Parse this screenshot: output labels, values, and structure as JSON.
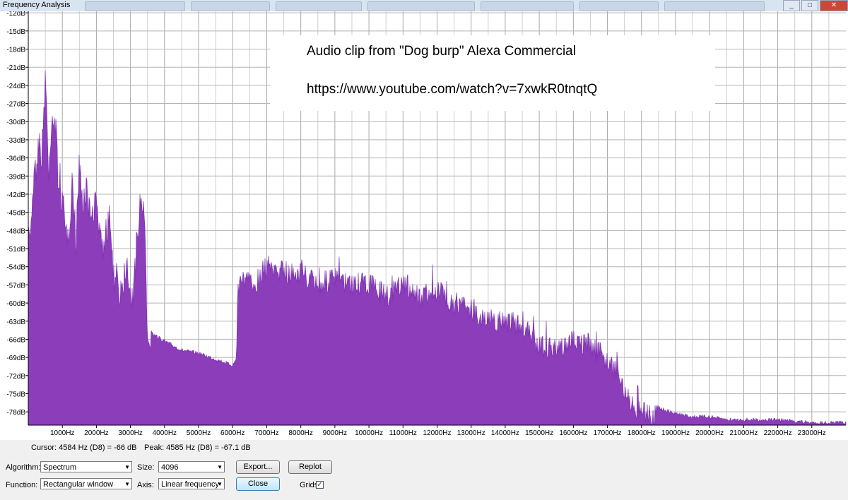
{
  "window": {
    "title": "Frequency Analysis"
  },
  "annotation": {
    "line1": "Audio clip from \"Dog burp\" Alexa Commercial",
    "line2": "https://www.youtube.com/watch?v=7xwkR0tnqtQ"
  },
  "chart_data": {
    "type": "area",
    "y_ticks": [
      "-12dB",
      "-15dB",
      "-18dB",
      "-21dB",
      "-24dB",
      "-27dB",
      "-30dB",
      "-33dB",
      "-36dB",
      "-39dB",
      "-42dB",
      "-45dB",
      "-48dB",
      "-51dB",
      "-54dB",
      "-57dB",
      "-60dB",
      "-63dB",
      "-66dB",
      "-69dB",
      "-72dB",
      "-75dB",
      "-78dB"
    ],
    "x_ticks": [
      "1000Hz",
      "2000Hz",
      "3000Hz",
      "4000Hz",
      "5000Hz",
      "6000Hz",
      "7000Hz",
      "8000Hz",
      "9000Hz",
      "10000Hz",
      "11000Hz",
      "12000Hz",
      "13000Hz",
      "14000Hz",
      "15000Hz",
      "16000Hz",
      "17000Hz",
      "18000Hz",
      "19000Hz",
      "20000Hz",
      "21000Hz",
      "22000Hz",
      "23000Hz"
    ],
    "xlim": [
      0,
      24000
    ],
    "ylim": [
      -80,
      -11
    ],
    "grid": true,
    "fill_color": "#8b3dba",
    "spectrum": {
      "x": [
        0,
        200,
        300,
        400,
        500,
        600,
        700,
        800,
        900,
        1000,
        1100,
        1200,
        1300,
        1400,
        1500,
        1600,
        1700,
        1800,
        1900,
        2000,
        2100,
        2200,
        2300,
        2400,
        2500,
        2600,
        2700,
        2800,
        2900,
        3000,
        3100,
        3200,
        3300,
        3400,
        3450,
        3500,
        3700,
        4000,
        4500,
        5000,
        5500,
        6000,
        6100,
        6150,
        6300,
        6600,
        7000,
        7500,
        8000,
        8500,
        9000,
        9500,
        10000,
        10500,
        11000,
        11500,
        12000,
        12500,
        13000,
        13500,
        14000,
        14500,
        15000,
        15500,
        16000,
        16500,
        17000,
        17300,
        17500,
        17800,
        18000,
        18500,
        19000,
        19500,
        20000,
        20500,
        21000,
        22000,
        23000,
        24000
      ],
      "y": [
        -48,
        -36,
        -30,
        -33,
        -19,
        -37,
        -26,
        -28,
        -38,
        -40,
        -46,
        -44,
        -36,
        -48,
        -33,
        -41,
        -38,
        -42,
        -44,
        -37,
        -47,
        -49,
        -45,
        -43,
        -55,
        -51,
        -57,
        -53,
        -49,
        -56,
        -55,
        -47,
        -38,
        -44,
        -48,
        -63,
        -65,
        -66,
        -67.5,
        -68,
        -69,
        -70,
        -69,
        -56,
        -54,
        -55,
        -52,
        -53,
        -53,
        -55,
        -54,
        -55,
        -55,
        -57,
        -55,
        -57,
        -56,
        -58,
        -59,
        -61,
        -61,
        -62,
        -65,
        -66,
        -64,
        -65,
        -68,
        -69,
        -73,
        -75,
        -76,
        -77,
        -78,
        -78.5,
        -78.5,
        -79,
        -79,
        -79,
        -79.5,
        -79.5
      ]
    }
  },
  "status": {
    "cursor": "Cursor: 4584 Hz (D8) = -66 dB",
    "peak": "Peak: 4585 Hz (D8) = -67.1 dB"
  },
  "controls": {
    "algorithm_label": "Algorithm:",
    "algorithm_value": "Spectrum",
    "size_label": "Size:",
    "size_value": "4096",
    "function_label": "Function:",
    "function_value": "Rectangular window",
    "axis_label": "Axis:",
    "axis_value": "Linear frequency",
    "export_label": "Export...",
    "replot_label": "Replot",
    "close_label": "Close",
    "grids_label": "Grids",
    "grids_checked": "✓"
  }
}
